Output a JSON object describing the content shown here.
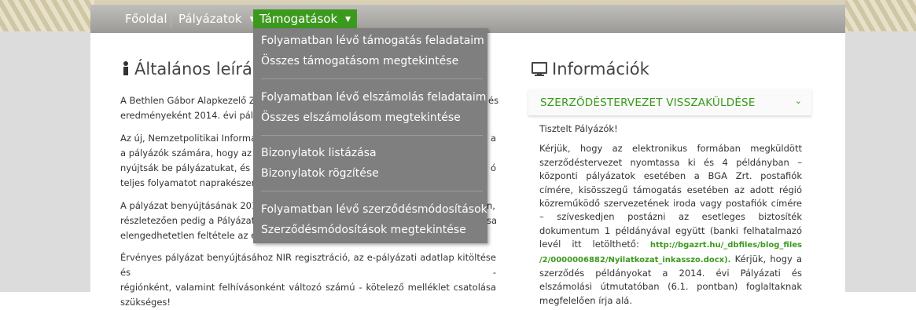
{
  "nav": {
    "items": [
      {
        "label": "Főoldal"
      },
      {
        "label": "Pályázatok",
        "caret": "▼"
      },
      {
        "label": "Támogatások",
        "caret": "▼"
      }
    ]
  },
  "dropdown": {
    "groups": [
      [
        "Folyamatban lévő támogatás feladataim",
        "Összes támogatásom megtekintése"
      ],
      [
        "Folyamatban lévő elszámolás feladataim",
        "Összes elszámolásom megtekintése"
      ],
      [
        "Bizonylatok listázása",
        "Bizonylatok rögzítése"
      ],
      [
        "Folyamatban lévő szerződésmódosítások",
        "Szerződésmódosítások megtekintése"
      ]
    ]
  },
  "left": {
    "title": "Általános leírás",
    "icon": "info-icon",
    "paragraphs": [
      [
        "A Bethlen Gábor Alapkezelő Zr",
        "eredményeként 2014. évi pályá"
      ],
      [
        "Az új, Nemzetpolitikai Informa",
        "a pályázók számára, hogy az",
        "nyújtsák be pályázatukat, és a",
        "teljes folyamatot naprakészen"
      ],
      [
        "A pályázat benyújtásának 201",
        "részletezően pedig a Pályázat",
        "elengedhetetlen feltétele az er"
      ],
      [
        "Érvényes pályázat benyújtásához NIR regisztráció, az e-pályázati adatlap kitöltése és -",
        "régiónként, valamint felhívásonként változó számú - kötelező melléklet csatolása",
        "szükséges!"
      ]
    ],
    "right_fragments": [
      "és",
      "a",
      "ó",
      "n,",
      "sa"
    ]
  },
  "right": {
    "title": "Információk",
    "icon": "monitor-icon",
    "accordion_label": "SZERZŐDÉSTERVEZET VISSZAKÜLDÉSE",
    "greeting": "Tisztelt Pályázók!",
    "body_lines": [
      "Kérjük, hogy az elektronikus formában megküldött",
      "szerződéstervezet nyomtassa ki és 4 példányban –",
      "központi pályázatok esetében a BGA Zrt. postafiók",
      "címére, kisösszegű támogatás esetében az adott régió",
      "közreműködő szervezetének iroda vagy postafiók címére",
      "– szíveskedjen postázni az esetleges biztosíték",
      "dokumentum 1 példányával együtt (banki felhatalmazó"
    ],
    "link_prefix": "levél itt letölthető:",
    "link_part1": "http://bgazrt.hu/_dbfiles/blog_files",
    "link_part2": "/2/0000006882/Nyilatkozat_inkasszo.docx).",
    "after_link": "Kérjük, hogy a",
    "tail_lines": [
      "szerződés példányokat a 2014. évi Pályázati és",
      "elszámolási útmutatóban (6.1. pontban) foglaltaknak",
      "megfelelően írja alá."
    ]
  },
  "colors": {
    "accent": "#3b9a1d",
    "dropdown_bg": "#7f7f7f"
  }
}
